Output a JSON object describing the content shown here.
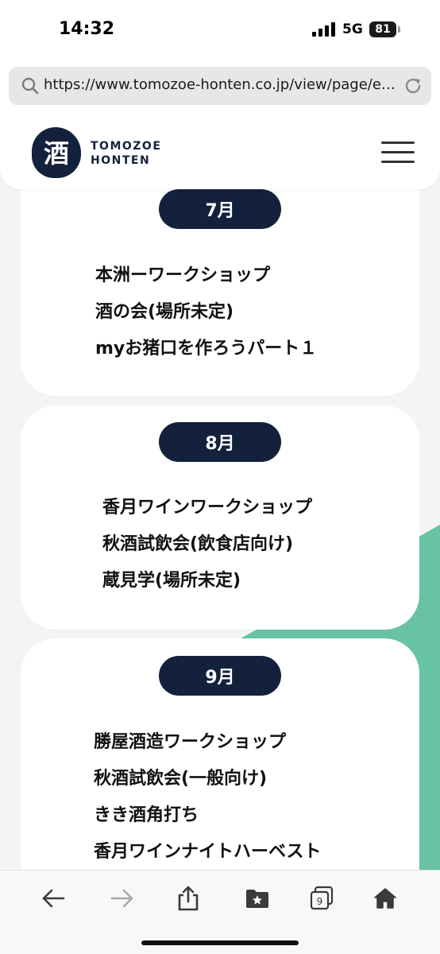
{
  "status_bar": {
    "time": "14:32",
    "network": "5G",
    "battery": "81",
    "icons": [
      "signal-bars-icon",
      "battery-icon"
    ]
  },
  "browser": {
    "url": "https://www.tomozoe-honten.co.jp/view/page/ev...",
    "icons": [
      "search-icon",
      "reload-icon"
    ]
  },
  "header": {
    "logo_mark_char": "酒",
    "logo_line1": "TOMOZOE",
    "logo_line2": "HONTEN",
    "icons": [
      "hamburger-menu-icon"
    ]
  },
  "months": [
    {
      "label": "7月",
      "events": [
        "本洲ーワークショップ",
        "酒の会(場所未定)",
        "myお猪口を作ろうパート１"
      ]
    },
    {
      "label": "8月",
      "events": [
        "香月ワインワークショップ",
        "秋酒試飲会(飲食店向け)",
        "蔵見学(場所未定)"
      ]
    },
    {
      "label": "9月",
      "events": [
        "勝屋酒造ワークショップ",
        "秋酒試飲会(一般向け)",
        "きき酒角打ち",
        "香月ワインナイトハーベスト"
      ]
    }
  ],
  "toolbar": {
    "tabs_count": "9",
    "icons": [
      "back-arrow-icon",
      "forward-arrow-icon",
      "share-icon",
      "bookmarks-icon",
      "tabs-icon",
      "home-icon"
    ]
  },
  "colors": {
    "navy": "#14213d",
    "green": "#68c3a3",
    "background": "#f4f4f4"
  }
}
